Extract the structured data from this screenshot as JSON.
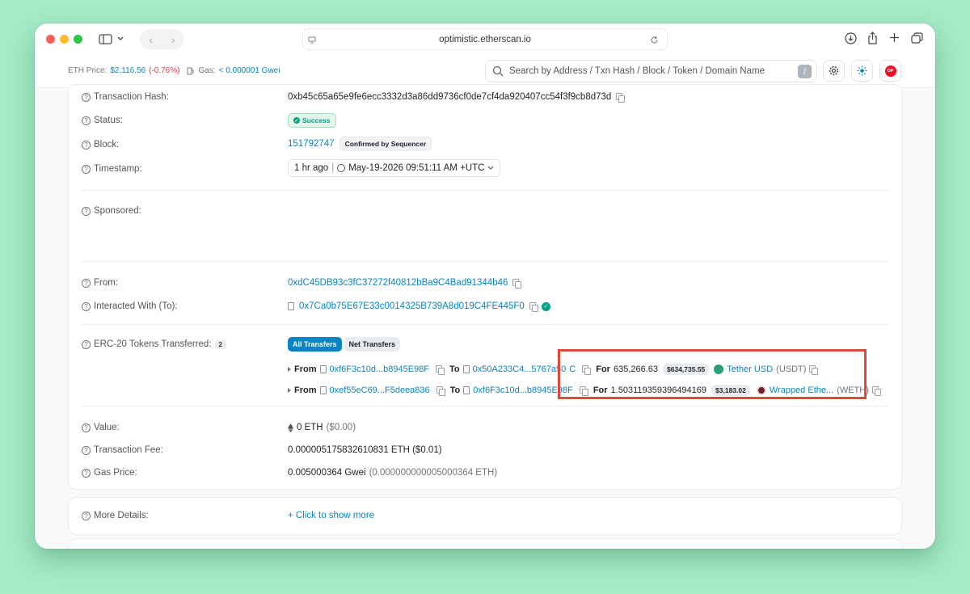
{
  "browser": {
    "url": "optimistic.etherscan.io"
  },
  "header": {
    "eth_price_label": "ETH Price:",
    "eth_price": "$2,116.56",
    "eth_change": "(-0.76%)",
    "gas_label": "Gas:",
    "gas_value": "< 0.000001 Gwei",
    "search_placeholder": "Search by Address / Txn Hash / Block / Token / Domain Name",
    "search_shortcut": "/",
    "op_badge": "OP"
  },
  "tx": {
    "hash_label": "Transaction Hash:",
    "hash": "0xb45c65a65e9fe6ecc3332d3a86dd9736cf0de7cf4da920407cc54f3f9cb8d73d",
    "status_label": "Status:",
    "status": "Success",
    "block_label": "Block:",
    "block": "151792747",
    "block_badge": "Confirmed by Sequencer",
    "timestamp_label": "Timestamp:",
    "timestamp_ago": "1 hr ago",
    "timestamp_sep": "|",
    "timestamp": "May-19-2026 09:51:11 AM +UTC",
    "sponsored_label": "Sponsored:",
    "from_label": "From:",
    "from": "0xdC45DB93c3fC37272f40812bBa9C4Bad91344b46",
    "to_label": "Interacted With (To):",
    "to": "0x7Ca0b75E67E33c0014325B739A8d019C4FE445F0",
    "erc20_label": "ERC-20 Tokens Transferred:",
    "erc20_count": "2",
    "tab_all": "All Transfers",
    "tab_net": "Net Transfers",
    "transfers": [
      {
        "from_kw": "From",
        "from": "0xf6F3c10d...b8945E98F",
        "to_kw": "To",
        "to": "0x50A233C4...5767a50",
        "to_tail": "C",
        "for_kw": "For",
        "amount": "635,266.63",
        "usd": "$634,735.55",
        "token": "Tether USD",
        "symbol": "(USDT)"
      },
      {
        "from_kw": "From",
        "from": "0xef55eC69...F5deea836",
        "to_kw": "To",
        "to": "0xf6F3c10d...b8945E98F",
        "for_kw": "For",
        "amount": "1.503119359396494169",
        "usd": "$3,183.02",
        "token": "Wrapped Ethe...",
        "symbol": "(WETH)"
      }
    ],
    "value_label": "Value:",
    "value": "0 ETH",
    "value_usd": "($0.00)",
    "fee_label": "Transaction Fee:",
    "fee": "0.000005175832610831 ETH ($0.01)",
    "gas_price_label": "Gas Price:",
    "gas_price": "0.005000364 Gwei",
    "gas_price_eth": "(0.000000000005000364 ETH)",
    "more_label": "More Details:",
    "more_link": "+ Click to show more"
  },
  "colors": {
    "accent": "#0784c3",
    "highlight": "#e2463c",
    "background": "#a3ecc6"
  }
}
